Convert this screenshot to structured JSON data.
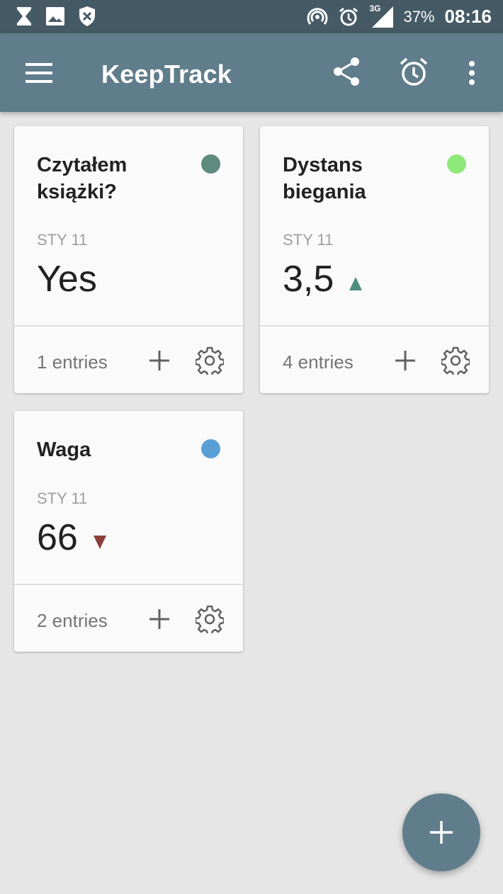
{
  "status_bar": {
    "battery": "37%",
    "time": "08:16",
    "network": "3G"
  },
  "app_bar": {
    "title": "KeepTrack",
    "icons": [
      "menu-icon",
      "share-icon",
      "alarm-icon",
      "more-vert-icon"
    ]
  },
  "cards": [
    {
      "title": "Czytałem książki?",
      "dot_color": "#5f8a7e",
      "date": "STY 11",
      "value": "Yes",
      "trend": "none",
      "entries": "1 entries"
    },
    {
      "title": "Dystans biegania",
      "dot_color": "#8ee87a",
      "date": "STY 11",
      "value": "3,5",
      "trend": "up",
      "entries": "4 entries"
    },
    {
      "title": "Waga",
      "dot_color": "#5a9ed6",
      "date": "STY 11",
      "value": "66",
      "trend": "down",
      "entries": "2 entries"
    }
  ],
  "colors": {
    "status_bar": "#455a64",
    "app_bar": "#607d8b",
    "background": "#e6e6e6",
    "fab": "#607d8b",
    "trend_up": "#4e8e80",
    "trend_down": "#8b3f38"
  }
}
